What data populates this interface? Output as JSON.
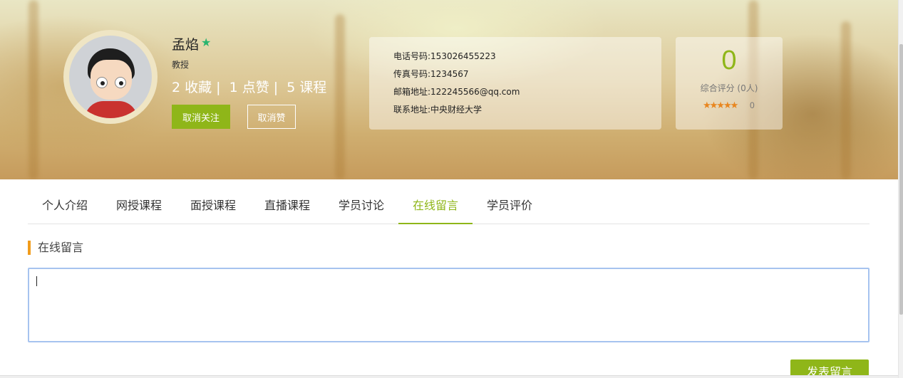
{
  "profile": {
    "name": "孟焰",
    "level_icon": "star-icon",
    "title": "教授",
    "stats": [
      {
        "count": "2",
        "label": "收藏 |"
      },
      {
        "count": "1",
        "label": "点赞 |"
      },
      {
        "count": "5",
        "label": "课程"
      }
    ],
    "unfollow_label": "取消关注",
    "unlike_label": "取消赞"
  },
  "contact": {
    "phone": "电话号码:153026455223",
    "fax": "传真号码:1234567",
    "email": "邮箱地址:122245566@qq.com",
    "address": "联系地址:中央财经大学"
  },
  "rating": {
    "score": "0",
    "label": "综合评分 (0人)",
    "stars": "★★★★★",
    "stars_value": "0"
  },
  "tabs": [
    {
      "label": "个人介绍"
    },
    {
      "label": "网授课程"
    },
    {
      "label": "面授课程"
    },
    {
      "label": "直播课程"
    },
    {
      "label": "学员讨论"
    },
    {
      "label": "在线留言"
    },
    {
      "label": "学员评价"
    }
  ],
  "active_tab": "在线留言",
  "message": {
    "section_title": "在线留言",
    "input_value": "",
    "post_label": "发表留言"
  },
  "colors": {
    "accent": "#8fb619",
    "section_bar": "#f19c1c",
    "star": "#e8861f",
    "input_border": "#a6c3ef"
  }
}
